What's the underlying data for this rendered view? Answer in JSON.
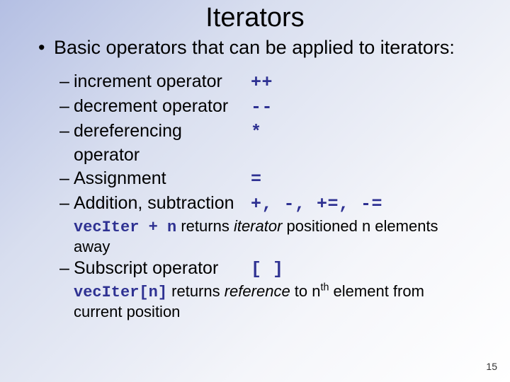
{
  "title": "Iterators",
  "intro": "Basic operators that can be applied to iterators:",
  "ops": [
    {
      "label": "increment operator",
      "sym": "++"
    },
    {
      "label": "decrement operator",
      "sym": "--"
    },
    {
      "label": "dereferencing operator",
      "sym": "*"
    },
    {
      "label": "Assignment",
      "sym": "="
    },
    {
      "label": "Addition, subtraction",
      "sym": "+, -, +=, -="
    }
  ],
  "add_desc": {
    "code": "vecIter + n",
    "text_before": " returns ",
    "italic": "iterator",
    "text_after": " positioned n elements away"
  },
  "subscript": {
    "label": "Subscript operator",
    "sym": "[ ]"
  },
  "sub_desc": {
    "code": "vecIter[n]",
    "text_before": " returns ",
    "italic": "reference",
    "text_mid": " to n",
    "sup": "th",
    "text_after": " element from current position"
  },
  "page": "15"
}
